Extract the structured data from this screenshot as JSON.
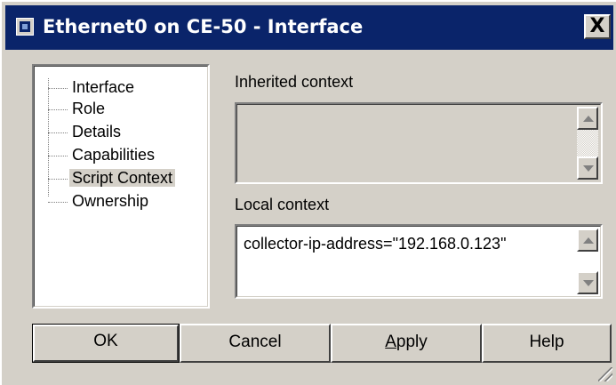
{
  "window": {
    "title": "Ethernet0 on CE-50 - Interface",
    "close_label": "X"
  },
  "tree": {
    "items": [
      {
        "label": "Interface"
      },
      {
        "label": "Role"
      },
      {
        "label": "Details"
      },
      {
        "label": "Capabilities"
      },
      {
        "label": "Script Context",
        "selected": true
      },
      {
        "label": "Ownership"
      }
    ]
  },
  "inherited": {
    "label": "Inherited context",
    "value": ""
  },
  "local": {
    "label": "Local context",
    "value": "collector-ip-address=\"192.168.0.123\""
  },
  "buttons": {
    "ok": "OK",
    "cancel": "Cancel",
    "apply_pre": "",
    "apply_ul": "A",
    "apply_post": "pply",
    "help": "Help"
  }
}
